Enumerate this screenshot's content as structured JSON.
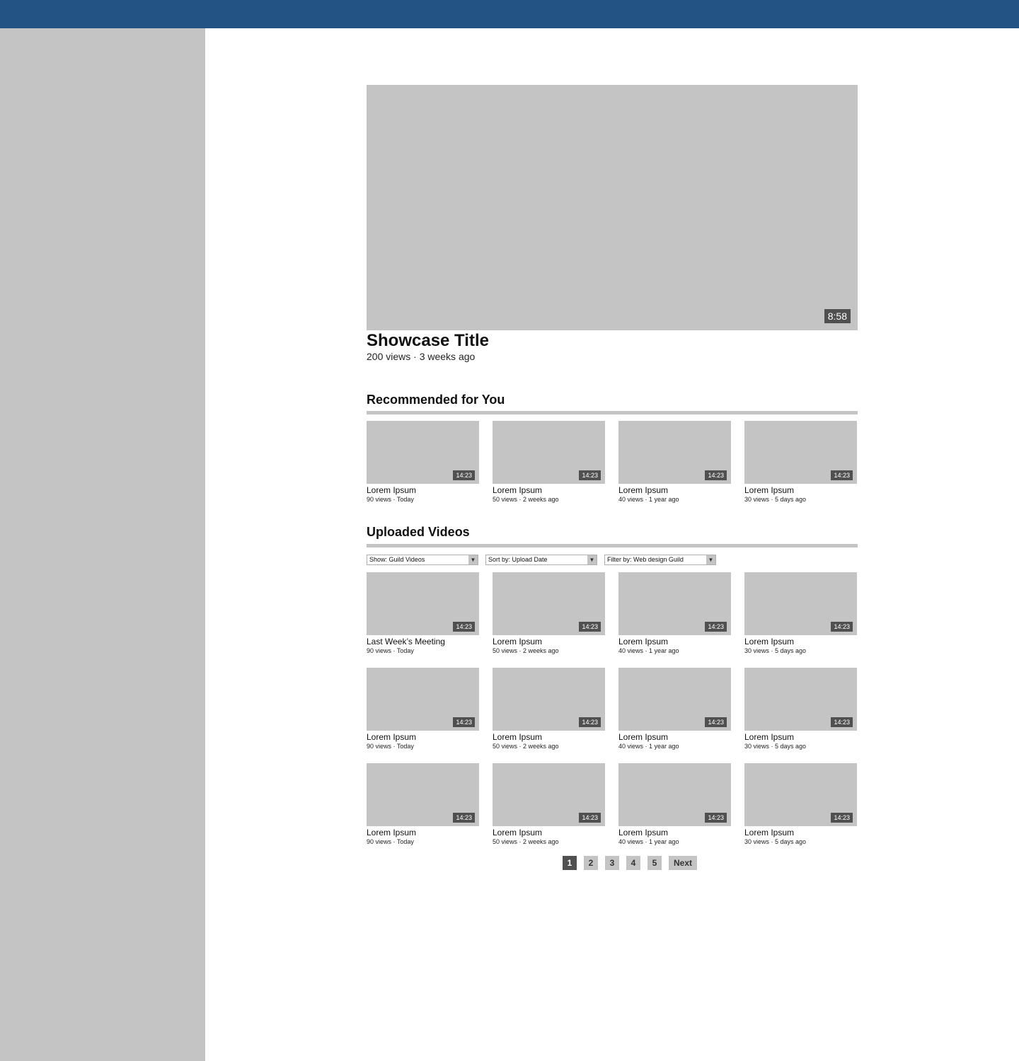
{
  "showcase": {
    "duration": "8:58",
    "title": "Showcase Title",
    "meta": "200 views · 3 weeks ago"
  },
  "recommended": {
    "title": "Recommended for You",
    "videos": [
      {
        "title": "Lorem Ipsum",
        "meta": "90 views · Today",
        "duration": "14:23"
      },
      {
        "title": "Lorem Ipsum",
        "meta": "50 views · 2 weeks ago",
        "duration": "14:23"
      },
      {
        "title": "Lorem Ipsum",
        "meta": "40 views · 1 year ago",
        "duration": "14:23"
      },
      {
        "title": "Lorem Ipsum",
        "meta": "30 views · 5 days ago",
        "duration": "14:23"
      }
    ]
  },
  "uploaded": {
    "title": "Uploaded Videos",
    "filters": {
      "show": "Show: Guild Videos",
      "sort": "Sort by: Upload Date",
      "filter": "Filter by: Web design Guild",
      "arrow": "▼"
    },
    "videos": [
      {
        "title": "Last Week’s Meeting",
        "meta": "90 views · Today",
        "duration": "14:23"
      },
      {
        "title": "Lorem Ipsum",
        "meta": "50 views · 2 weeks ago",
        "duration": "14:23"
      },
      {
        "title": "Lorem Ipsum",
        "meta": "40 views · 1 year ago",
        "duration": "14:23"
      },
      {
        "title": "Lorem Ipsum",
        "meta": "30 views · 5 days ago",
        "duration": "14:23"
      },
      {
        "title": "Lorem Ipsum",
        "meta": "90 views · Today",
        "duration": "14:23"
      },
      {
        "title": "Lorem Ipsum",
        "meta": "50 views · 2 weeks ago",
        "duration": "14:23"
      },
      {
        "title": "Lorem Ipsum",
        "meta": "40 views · 1 year ago",
        "duration": "14:23"
      },
      {
        "title": "Lorem Ipsum",
        "meta": "30 views · 5 days ago",
        "duration": "14:23"
      },
      {
        "title": "Lorem Ipsum",
        "meta": "90 views · Today",
        "duration": "14:23"
      },
      {
        "title": "Lorem Ipsum",
        "meta": "50 views · 2 weeks ago",
        "duration": "14:23"
      },
      {
        "title": "Lorem Ipsum",
        "meta": "40 views · 1 year ago",
        "duration": "14:23"
      },
      {
        "title": "Lorem Ipsum",
        "meta": "30 views · 5 days ago",
        "duration": "14:23"
      }
    ]
  },
  "pagination": {
    "pages": [
      "1",
      "2",
      "3",
      "4",
      "5"
    ],
    "current": "1",
    "next": "Next"
  },
  "colors": {
    "topbar": "#235284",
    "placeholder": "#c4c4c4",
    "duration_badge": "#505050"
  }
}
